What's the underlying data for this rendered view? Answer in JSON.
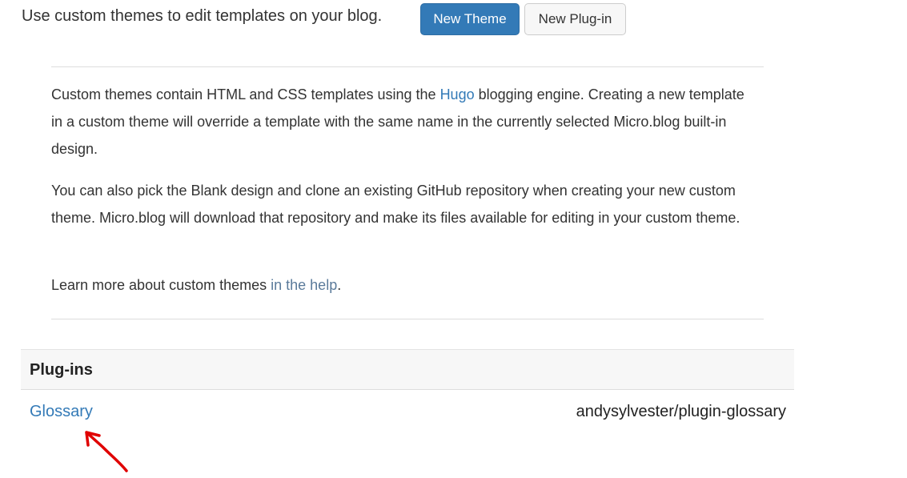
{
  "header": {
    "intro": "Use custom themes to edit templates on your blog.",
    "new_theme_label": "New Theme",
    "new_plugin_label": "New Plug-in"
  },
  "info": {
    "p1_before": "Custom themes contain HTML and CSS templates using the ",
    "p1_link": "Hugo",
    "p1_after": " blogging engine. Creating a new template in a custom theme will override a template with the same name in the currently selected Micro.blog built-in design.",
    "p2": "You can also pick the Blank design and clone an existing GitHub repository when creating your new custom theme. Micro.blog will download that repository and make its files available for editing in your custom theme.",
    "p3_before": "Learn more about custom themes ",
    "p3_link": "in the help",
    "p3_after": "."
  },
  "plugins": {
    "heading": "Plug-ins",
    "items": [
      {
        "name": "Glossary",
        "repo": "andysylvester/plugin-glossary"
      }
    ]
  },
  "colors": {
    "primary": "#337ab7",
    "annotation": "#e00000"
  }
}
